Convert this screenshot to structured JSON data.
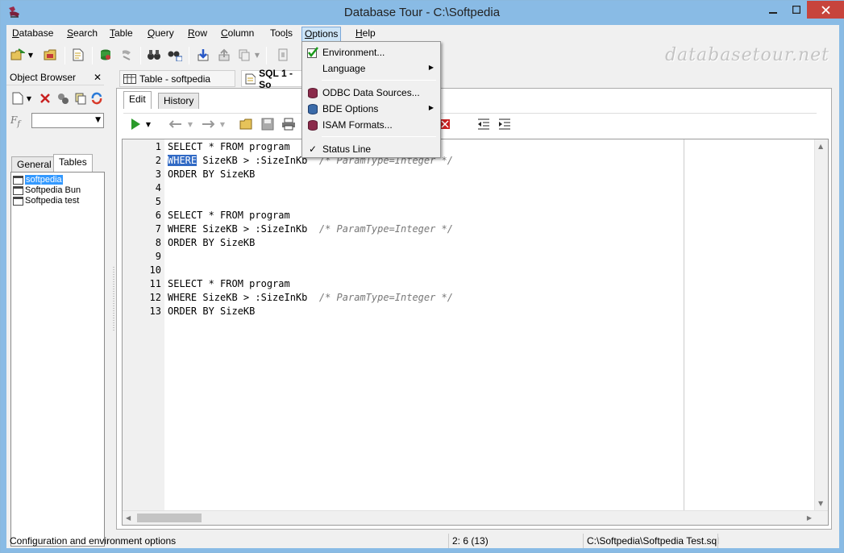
{
  "window": {
    "title": "Database Tour - C:\\Softpedia"
  },
  "menubar": [
    {
      "label": "Database",
      "u": "D",
      "rest": "atabase"
    },
    {
      "label": "Search",
      "u": "S",
      "rest": "earch"
    },
    {
      "label": "Table",
      "u": "T",
      "rest": "able"
    },
    {
      "label": "Query",
      "u": "Q",
      "rest": "uery"
    },
    {
      "label": "Row",
      "u": "R",
      "rest": "ow"
    },
    {
      "label": "Column",
      "u": "C",
      "rest": "olumn"
    },
    {
      "label": "Tools",
      "pre": "Too",
      "u": "l",
      "rest": "s"
    },
    {
      "label": "Options",
      "u": "O",
      "rest": "ptions"
    },
    {
      "label": "Help",
      "u": "H",
      "rest": "elp"
    }
  ],
  "watermark": "databasetour.net",
  "object_browser": {
    "title": "Object Browser",
    "tabs": [
      "General",
      "Tables"
    ],
    "items": [
      "softpedia",
      "Softpedia Bun",
      "Softpedia test"
    ]
  },
  "doc_tabs": [
    "Table - softpedia",
    "SQL 1 - So"
  ],
  "sub_tabs": [
    "Edit",
    "History"
  ],
  "editor": {
    "lines": [
      {
        "n": "1",
        "code": "SELECT * FROM program",
        "comment": ""
      },
      {
        "n": "2",
        "pre": "WHERE",
        "code": " SizeKB > :SizeInKb  ",
        "comment": "/* ParamType=Integer */"
      },
      {
        "n": "3",
        "code": "ORDER BY SizeKB",
        "comment": ""
      },
      {
        "n": "4",
        "code": "",
        "comment": ""
      },
      {
        "n": "5",
        "code": "",
        "comment": ""
      },
      {
        "n": "6",
        "code": "SELECT * FROM program",
        "comment": ""
      },
      {
        "n": "7",
        "code": "WHERE SizeKB > :SizeInKb  ",
        "comment": "/* ParamType=Integer */"
      },
      {
        "n": "8",
        "code": "ORDER BY SizeKB",
        "comment": ""
      },
      {
        "n": "9",
        "code": "",
        "comment": ""
      },
      {
        "n": "10",
        "code": "",
        "comment": ""
      },
      {
        "n": "11",
        "code": "SELECT * FROM program",
        "comment": ""
      },
      {
        "n": "12",
        "code": "WHERE SizeKB > :SizeInKb  ",
        "comment": "/* ParamType=Integer */"
      },
      {
        "n": "13",
        "code": "ORDER BY SizeKB",
        "comment": ""
      }
    ]
  },
  "options_menu": {
    "environment": "Environment...",
    "language": "Language",
    "odbc": "ODBC Data Sources...",
    "bde": "BDE Options",
    "isam": "ISAM Formats...",
    "status_line": "Status Line"
  },
  "status": {
    "hint": "Configuration and environment options",
    "position": "2:  6 (13)",
    "file": "C:\\Softpedia\\Softpedia Test.sql"
  },
  "colors": {
    "titlebar": "#89bbe5",
    "close": "#c7443c",
    "selection": "#3399ff"
  }
}
